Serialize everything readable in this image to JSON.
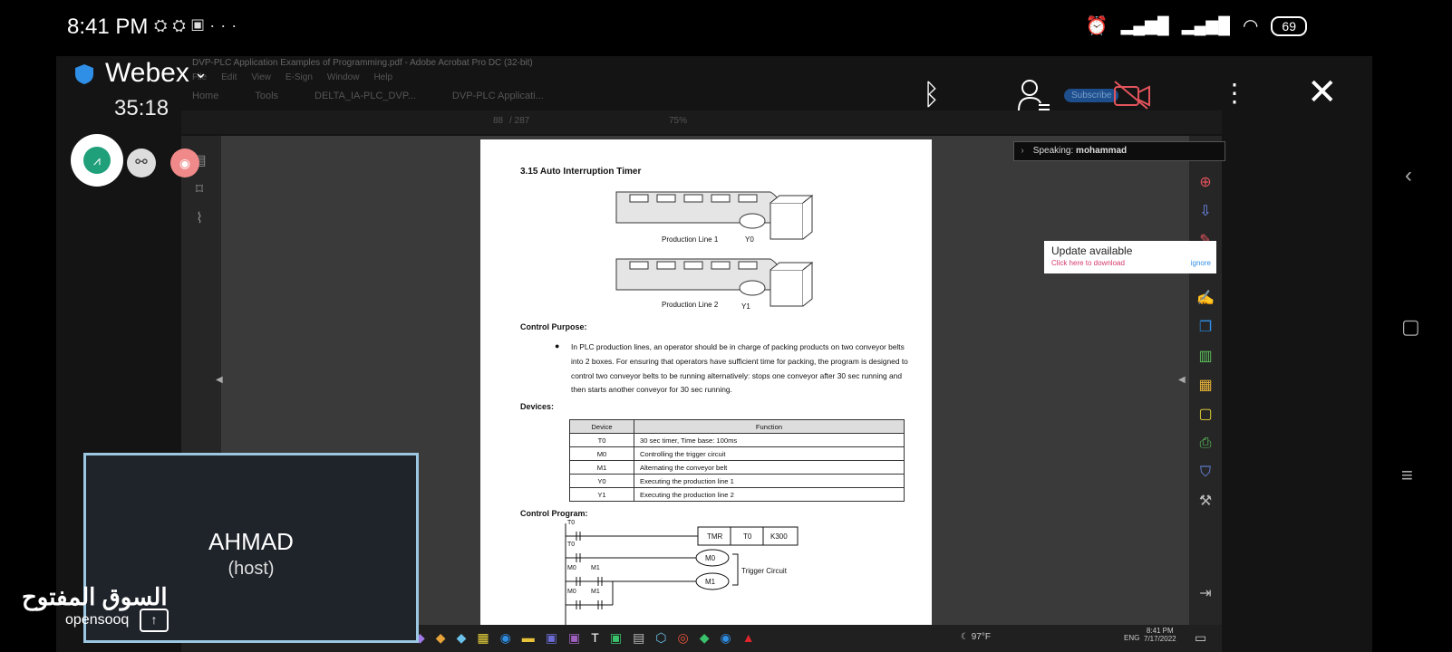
{
  "status_bar": {
    "time": "8:41 PM",
    "battery": "69"
  },
  "webex": {
    "app_name": "Webex",
    "timer": "35:18"
  },
  "acrobat": {
    "window_title": "DVP-PLC Application Examples of Programming.pdf - Adobe Acrobat Pro DC (32-bit)",
    "menu": [
      "File",
      "Edit",
      "View",
      "E-Sign",
      "Window",
      "Help"
    ],
    "tabs": [
      "Home",
      "Tools",
      "DELTA_IA-PLC_DVP...",
      "DVP-PLC Applicati..."
    ],
    "toolbar": {
      "page_current": "88",
      "page_total": "/ 287",
      "zoom": "75%"
    },
    "subscribe_label": "Subscribe"
  },
  "speaking": {
    "label": "Speaking:",
    "name": "mohammad"
  },
  "update_toast": {
    "title": "Update available",
    "link": "Click here to download",
    "ignore": "ignore"
  },
  "document": {
    "heading": "3.15   Auto Interruption Timer",
    "line1_label": "Production Line 1",
    "line1_output": "Y0",
    "line2_label": "Production Line 2",
    "line2_output": "Y1",
    "control_purpose_title": "Control Purpose:",
    "control_purpose_text": "In PLC production lines, an operator should be in charge of packing products on two conveyor belts into 2 boxes. For ensuring that operators have sufficient time for packing, the program is designed to control two conveyor belts to be running alternatively: stops one conveyor after 30 sec running and then starts another conveyor for 30 sec running.",
    "devices_title": "Devices:",
    "table_headers": [
      "Device",
      "Function"
    ],
    "table_rows": [
      [
        "T0",
        "30 sec timer, Time base: 100ms"
      ],
      [
        "M0",
        "Controlling the trigger circuit"
      ],
      [
        "M1",
        "Alternating the conveyor belt"
      ],
      [
        "Y0",
        "Executing the production line 1"
      ],
      [
        "Y1",
        "Executing the production line 2"
      ]
    ],
    "control_program_title": "Control Program:",
    "ladder": {
      "t0_top": "T0",
      "t0_second": "T0",
      "m0_a": "M0",
      "m1_a": "M1",
      "m0_b": "M0",
      "m1_b": "M1",
      "tmr": "TMR",
      "tmr_dev": "T0",
      "tmr_k": "K300",
      "coil_m0": "M0",
      "coil_m1": "M1",
      "trigger_label": "Trigger Circuit"
    }
  },
  "taskbar": {
    "temperature": "97°F",
    "lang": "ENG",
    "clock_time": "8:41 PM",
    "clock_date": "7/17/2022"
  },
  "video_tile": {
    "name": "AHMAD",
    "role": "(host)"
  },
  "watermark": {
    "arabic": "السوق المفتوح",
    "latin": "opensooq"
  },
  "colors": {
    "accent_blue": "#2f8fe6",
    "video_border": "#9cc7e0",
    "camera_off": "#e2545c",
    "record": "#f08a8a",
    "webex_green": "#1fa07a"
  }
}
